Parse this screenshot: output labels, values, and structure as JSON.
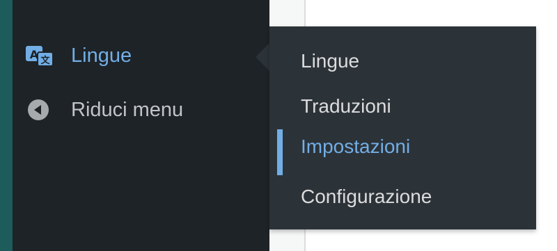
{
  "sidebar": {
    "items": [
      {
        "label": "Lingue",
        "icon": "translate-icon",
        "active": true
      },
      {
        "label": "Riduci menu",
        "icon": "collapse-menu-icon",
        "active": false
      }
    ]
  },
  "submenu": {
    "items": [
      {
        "label": "Lingue"
      },
      {
        "label": "Traduzioni"
      },
      {
        "label": "Impostazioni",
        "current": true
      },
      {
        "label": "Configurazione"
      }
    ]
  },
  "colors": {
    "sidebar_bg": "#1e2327",
    "submenu_bg": "#2c3338",
    "accent": "#72aee6",
    "text_default": "#c3c4c7",
    "edge_strip": "#1d5c5a"
  }
}
